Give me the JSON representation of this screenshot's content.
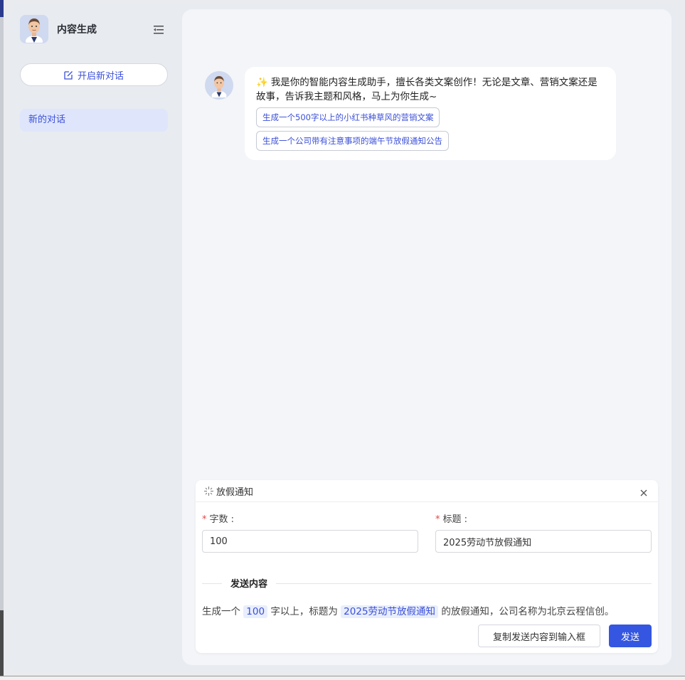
{
  "sidebar": {
    "brand_title": "内容生成",
    "new_chat_label": "开启新对话",
    "conversations": [
      {
        "label": "新的对话",
        "active": true
      }
    ]
  },
  "chat": {
    "greeting_emoji": "✨",
    "greeting": "我是你的智能内容生成助手，擅长各类文案创作！无论是文章、营销文案还是故事，告诉我主题和风格，马上为你生成~",
    "suggestions": [
      "生成一个500字以上的小红书种草风的营销文案",
      "生成一个公司带有注意事项的端午节放假通知公告"
    ]
  },
  "panel": {
    "title": "放假通知",
    "fields": {
      "count": {
        "label": "字数",
        "value": "100"
      },
      "title": {
        "label": "标题",
        "value": "2025劳动节放假通知"
      }
    },
    "section_label": "发送内容",
    "preview": {
      "part1": "生成一个",
      "count": "100",
      "part2": "字以上，标题为",
      "title": "2025劳动节放假通知",
      "part3": "的放假通知，公司名称为北京云程信创。"
    },
    "copy_button": "复制发送内容到输入框",
    "send_button": "发送"
  },
  "colors": {
    "accent": "#3456e0",
    "link": "#3b4fd8",
    "active_bg": "#dfe6fb",
    "required": "#e54545"
  }
}
